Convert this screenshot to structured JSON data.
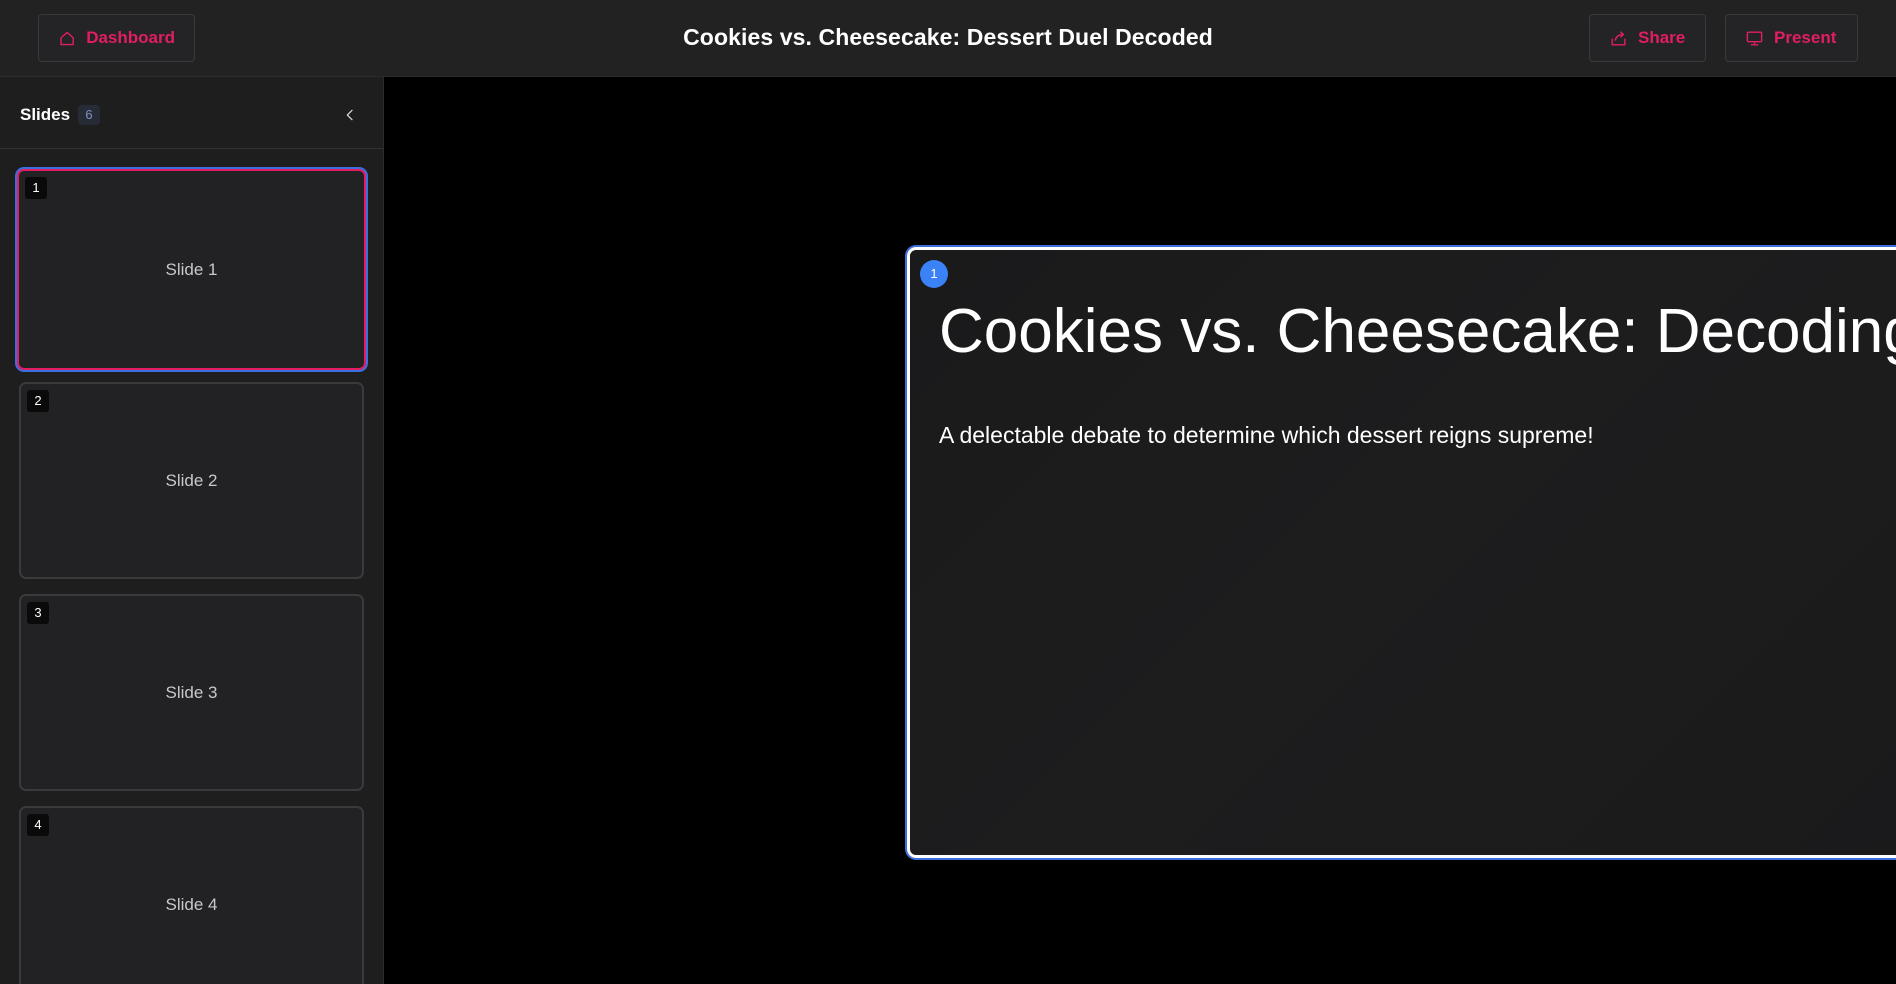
{
  "header": {
    "dashboard_label": "Dashboard",
    "title": "Cookies vs. Cheesecake: Dessert Duel Decoded",
    "share_label": "Share",
    "present_label": "Present"
  },
  "sidebar": {
    "title": "Slides",
    "count": "6",
    "thumbnails": [
      {
        "num": "1",
        "label": "Slide 1"
      },
      {
        "num": "2",
        "label": "Slide 2"
      },
      {
        "num": "3",
        "label": "Slide 3"
      },
      {
        "num": "4",
        "label": "Slide 4"
      }
    ]
  },
  "slide": {
    "number": "1",
    "menu": "⋮",
    "title": "Cookies vs. Cheesecake: Decoding the",
    "subtitle": "A delectable debate to determine which dessert reigns supreme!"
  },
  "colors": {
    "accent": "#e11d63",
    "selection": "#3b6fe0",
    "badge": "#3b82f6"
  },
  "icons": {
    "dashboard": "home-icon",
    "share": "share-icon",
    "present": "monitor-icon",
    "collapse": "chevron-left-icon"
  }
}
